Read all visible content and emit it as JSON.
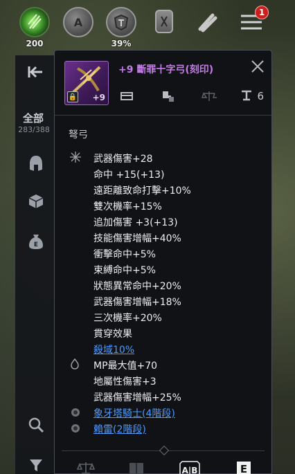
{
  "topbar": {
    "items": [
      {
        "icon": "green-orb-icon",
        "label": "200"
      },
      {
        "icon": "money-bag-a-icon",
        "glyph": "A",
        "label": ""
      },
      {
        "icon": "weight-shield-icon",
        "label": "39%"
      },
      {
        "icon": "rune-tablet-icon",
        "label": ""
      },
      {
        "icon": "scroll-icon",
        "label": ""
      },
      {
        "icon": "menu-icon",
        "label": ""
      }
    ],
    "menu_badge": "1"
  },
  "sidebar": {
    "category_label": "全部",
    "category_count": "283/388",
    "icons": [
      "back-arrow-icon",
      "helmet-icon",
      "box-icon",
      "money-bag-e-icon",
      "search-icon",
      "filter-icon"
    ]
  },
  "item": {
    "title": "+9 斷罪十字弓(刻印)",
    "enhance_badge": "+9",
    "weapon_type": "弩弓",
    "weight_value": "6",
    "icon_row": [
      "chest-icon",
      "anvil-icon",
      "scale-icon",
      "weight-icon"
    ]
  },
  "stats": {
    "group1": [
      "武器傷害+28",
      "命中 +15(+13)",
      "遠距離致命打擊+10%",
      "雙次機率+15%",
      "追加傷害 +3(+13)",
      "技能傷害增幅+40%",
      "衝擊命中+5%",
      "束縛命中+5%",
      "狀態異常命中+20%",
      "武器傷害增幅+18%",
      "三次機率+20%",
      "貫穿效果"
    ],
    "group1_link": "殺域10%",
    "group2": [
      "MP最大值+70",
      "地屬性傷害+3",
      "武器傷害增幅+25%"
    ],
    "set_links": [
      "象牙塔騎士(4階段)",
      "賴雷(2階段)"
    ]
  },
  "bottom_bar": {
    "icons": [
      "scale-icon",
      "book-icon",
      "ab-compare-icon",
      "e-tab-icon"
    ],
    "ab_label": "A|B",
    "e_label": "E"
  },
  "colors": {
    "item_title": "#c27de6",
    "link": "#4d9bff",
    "panel_bg": "#101216"
  }
}
